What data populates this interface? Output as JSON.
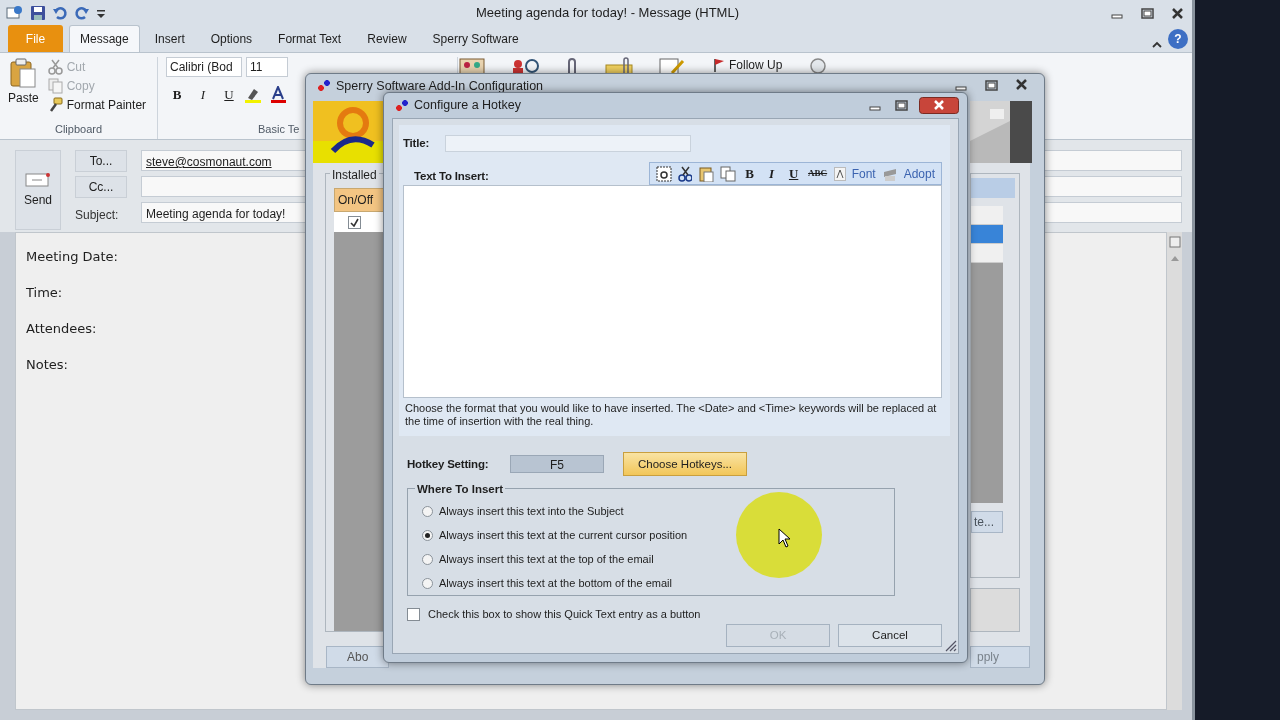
{
  "outlook": {
    "title": "Meeting agenda for today!  -  Message (HTML)",
    "tabs": [
      {
        "label": "File",
        "kind": "backstage",
        "selected": false
      },
      {
        "label": "Message",
        "kind": "tab",
        "selected": true
      },
      {
        "label": "Insert",
        "kind": "tab",
        "selected": false
      },
      {
        "label": "Options",
        "kind": "tab",
        "selected": false
      },
      {
        "label": "Format Text",
        "kind": "tab",
        "selected": false
      },
      {
        "label": "Review",
        "kind": "tab",
        "selected": false
      },
      {
        "label": "Sperry Software",
        "kind": "tab",
        "selected": false
      }
    ],
    "help": "?",
    "clipboard": {
      "paste": "Paste",
      "commands": [
        {
          "label": "Cut",
          "disabled": true
        },
        {
          "label": "Copy",
          "disabled": true
        },
        {
          "label": "Format Painter",
          "disabled": false
        }
      ],
      "label": "Clipboard"
    },
    "basic_text": {
      "font": "Calibri (Bod",
      "size": "11",
      "styles": [
        "B",
        "I",
        "U"
      ],
      "label": "Basic Te"
    },
    "follow_up": "Follow Up",
    "send": "Send",
    "to_button": "To...",
    "cc_button": "Cc...",
    "subject_label": "Subject:",
    "to": "steve@cosmonaut.com",
    "subject": "Meeting agenda for today!",
    "body": [
      "Meeting Date:",
      "Time:",
      "Attendees:",
      "Notes:"
    ]
  },
  "addin": {
    "title": "Sperry Software Add-In Configuration",
    "group": "Installed",
    "column": "On/Off",
    "rows": [
      {
        "checked": true
      }
    ],
    "list": [
      {
        "selected": false
      },
      {
        "selected": true
      },
      {
        "selected": false
      }
    ],
    "side_button": "te...",
    "about_button": "Abo",
    "apply_button": "pply"
  },
  "hotkey": {
    "title": "Configure a Hotkey",
    "title_label": "Title:",
    "text_label": "Text To Insert:",
    "styles": [
      "B",
      "I",
      "U",
      "ABC"
    ],
    "font": "Font",
    "adopt": "Adopt",
    "help": "Choose the format that you would like to have inserted.  The <Date> and <Time> keywords will be replaced at the time of insertion with the real thing.",
    "hotkey_label": "Hotkey Setting:",
    "hotkey_value": "F5",
    "choose": {
      "label": "Choose Hotkeys...",
      "highlighted": true
    },
    "where_label": "Where To Insert",
    "options": [
      {
        "label": "Always insert this text into the Subject",
        "selected": false
      },
      {
        "label": "Always insert this text at the current cursor position",
        "selected": true
      },
      {
        "label": "Always insert this text at the top  of the email",
        "selected": false
      },
      {
        "label": "Always insert this text at the bottom  of the email",
        "selected": false
      }
    ],
    "button_entry": {
      "label": "Check this box to show this Quick Text entry as a button",
      "checked": false
    },
    "ok": {
      "label": "OK",
      "disabled": true
    },
    "cancel": {
      "label": "Cancel",
      "disabled": false
    }
  }
}
